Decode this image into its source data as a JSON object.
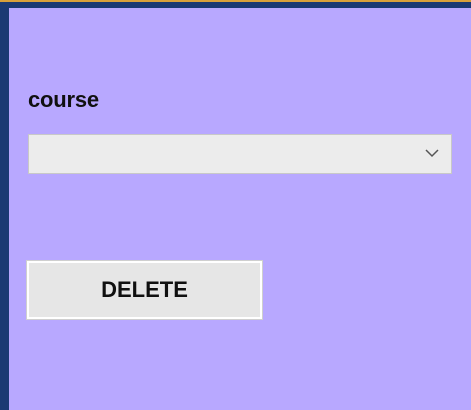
{
  "form": {
    "course_label": "course",
    "course_select": {
      "selected_value": "",
      "chevron_icon": "chevron-down-icon"
    },
    "delete_label": "DELETE"
  },
  "colors": {
    "panel_background": "#b8a8ff",
    "window_frame": "#1b3a73",
    "frame_accent": "#d9a13a",
    "control_background": "#ececec"
  }
}
